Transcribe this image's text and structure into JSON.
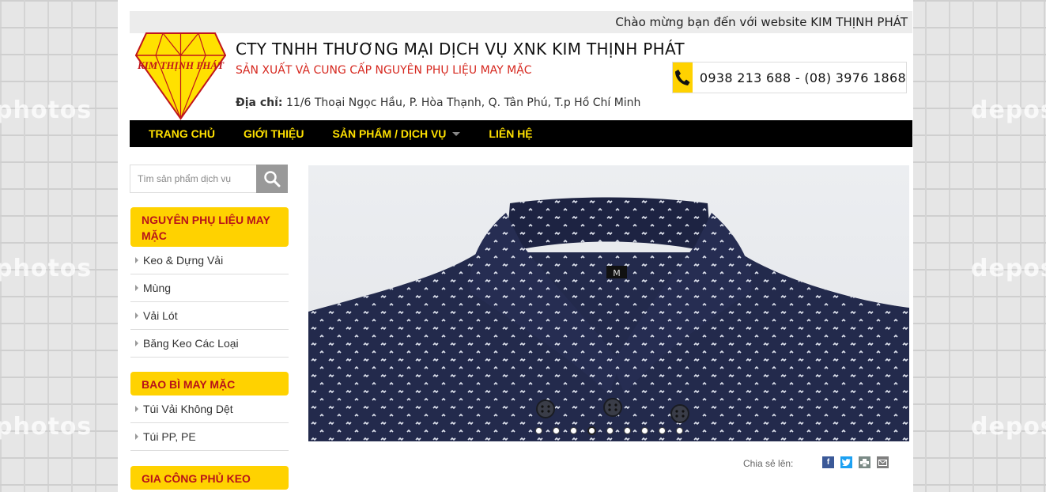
{
  "welcome": "Chào mừng bạn đến với website KIM THỊNH PHÁT",
  "logo": {
    "text": "KIM THỊNH PHÁT"
  },
  "header": {
    "company_name": "CTY TNHH THƯƠNG MẠI DỊCH VỤ XNK KIM THỊNH PHÁT",
    "slogan": "SẢN XUẤT VÀ CUNG CẤP NGUYÊN PHỤ LIỆU MAY MẶC",
    "address_label": "Địa chỉ:",
    "address": "11/6 Thoại Ngọc Hầu, P. Hòa Thạnh, Q. Tân Phú, T.p Hồ Chí Minh",
    "hotline": "0938 213 688 - (08) 3976 1868"
  },
  "nav": [
    {
      "label": "TRANG CHỦ"
    },
    {
      "label": "GIỚI THIỆU"
    },
    {
      "label": "SẢN PHẨM / DỊCH VỤ"
    },
    {
      "label": "LIÊN HỆ"
    }
  ],
  "search": {
    "placeholder": "Tìm sản phẩm dịch vụ"
  },
  "sidebar": {
    "groups": [
      {
        "title": "NGUYÊN PHỤ LIỆU MAY MẶC",
        "items": [
          "Keo & Dựng Vải",
          "Mùng",
          "Vải Lót",
          "Băng Keo Các Loại"
        ]
      },
      {
        "title": "BAO BÌ MAY MẶC",
        "items": [
          "Túi Vải Không Dệt",
          "Túi PP, PE"
        ]
      },
      {
        "title": "GIA CÔNG PHỦ KEO",
        "items": []
      }
    ]
  },
  "slider": {
    "slide_label": "M",
    "dot_count": 9,
    "active_index": 3
  },
  "share": {
    "label": "Chia sẻ lên:",
    "icons": [
      "facebook-icon",
      "twitter-icon",
      "print-icon",
      "email-icon"
    ]
  },
  "watermarks": [
    "photos",
    "deposit"
  ],
  "colors": {
    "accent": "#ffd200",
    "nav_bg": "#000000",
    "nav_text": "#ffe100",
    "slogan": "#d6281f",
    "category_text": "#b8121a"
  }
}
